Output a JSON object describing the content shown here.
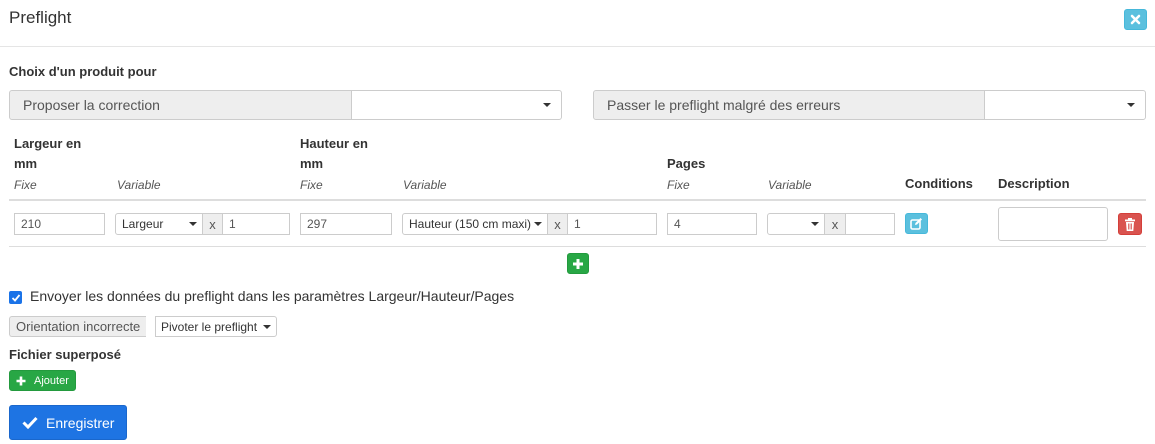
{
  "modal": {
    "title": "Preflight"
  },
  "choice": {
    "heading": "Choix d'un produit pour",
    "propose_label": "Proposer la correction",
    "propose_value": "",
    "pass_label": "Passer le preflight malgré des erreurs",
    "pass_value": ""
  },
  "columns": {
    "width_head_1": "Largeur en",
    "width_head_2": "mm",
    "height_head_1": "Hauteur en",
    "height_head_2": "mm",
    "pages_head": "Pages",
    "fixed": "Fixe",
    "variable": "Variable",
    "conditions": "Conditions",
    "description": "Description"
  },
  "row": {
    "width_fixed": "210",
    "width_var_select": "Largeur",
    "width_x": "x",
    "width_factor": "1",
    "height_fixed": "297",
    "height_var_select": "Hauteur (150 cm maxi)",
    "height_x": "x",
    "height_factor": "1",
    "pages_fixed": "4",
    "pages_var_select": "",
    "pages_x": "x",
    "pages_factor": "",
    "description": ""
  },
  "options": {
    "send_data_checked": true,
    "send_data_label": "Envoyer les données du preflight dans les paramètres Largeur/Hauteur/Pages",
    "orientation_label": "Orientation incorrecte",
    "orientation_value": "Pivoter le preflight"
  },
  "overlay": {
    "heading": "Fichier superposé",
    "add_label": "Ajouter"
  },
  "actions": {
    "save_label": "Enregistrer"
  },
  "colors": {
    "info": "#5bc0de",
    "success": "#28a745",
    "danger": "#d9534f",
    "primary": "#1e74e3"
  }
}
